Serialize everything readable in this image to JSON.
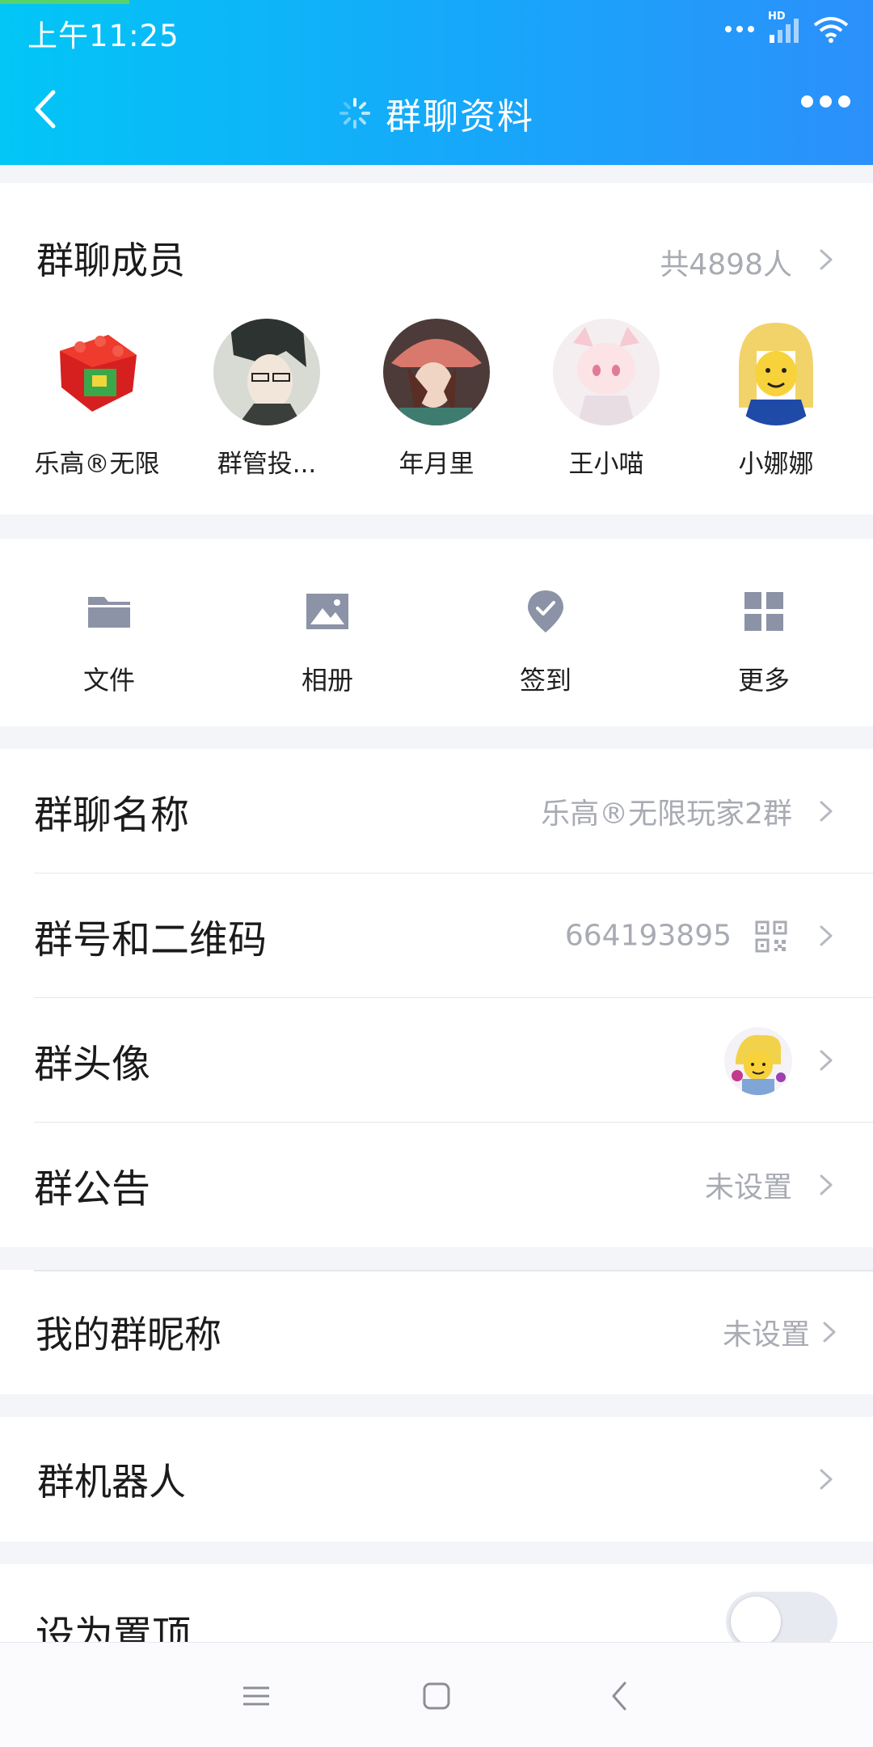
{
  "status_bar": {
    "time": "上午11:25",
    "network_tag": "HD"
  },
  "header": {
    "title": "群聊资料"
  },
  "members": {
    "heading": "群聊成员",
    "count": "共4898人",
    "list": [
      {
        "name": "乐高®无限"
      },
      {
        "name": "群管投..."
      },
      {
        "name": "年月里"
      },
      {
        "name": "王小喵"
      },
      {
        "name": "小娜娜"
      }
    ]
  },
  "tools": [
    {
      "label": "文件",
      "icon": "folder-icon"
    },
    {
      "label": "相册",
      "icon": "image-icon"
    },
    {
      "label": "签到",
      "icon": "checkin-icon"
    },
    {
      "label": "更多",
      "icon": "grid-icon"
    }
  ],
  "settings": {
    "group_name": {
      "label": "群聊名称",
      "value": "乐高®无限玩家2群"
    },
    "group_id": {
      "label": "群号和二维码",
      "value": "664193895"
    },
    "group_avatar": {
      "label": "群头像"
    },
    "announcement": {
      "label": "群公告",
      "value": "未设置"
    },
    "my_nickname": {
      "label": "我的群昵称",
      "value": "未设置"
    },
    "group_bot": {
      "label": "群机器人"
    },
    "pin_top": {
      "label": "设为置顶",
      "enabled": false
    }
  },
  "colors": {
    "header_start": "#02c6f6",
    "header_end": "#2c90fb",
    "secondary_text": "#a8abb3",
    "icon_gray": "#8d93a6"
  }
}
